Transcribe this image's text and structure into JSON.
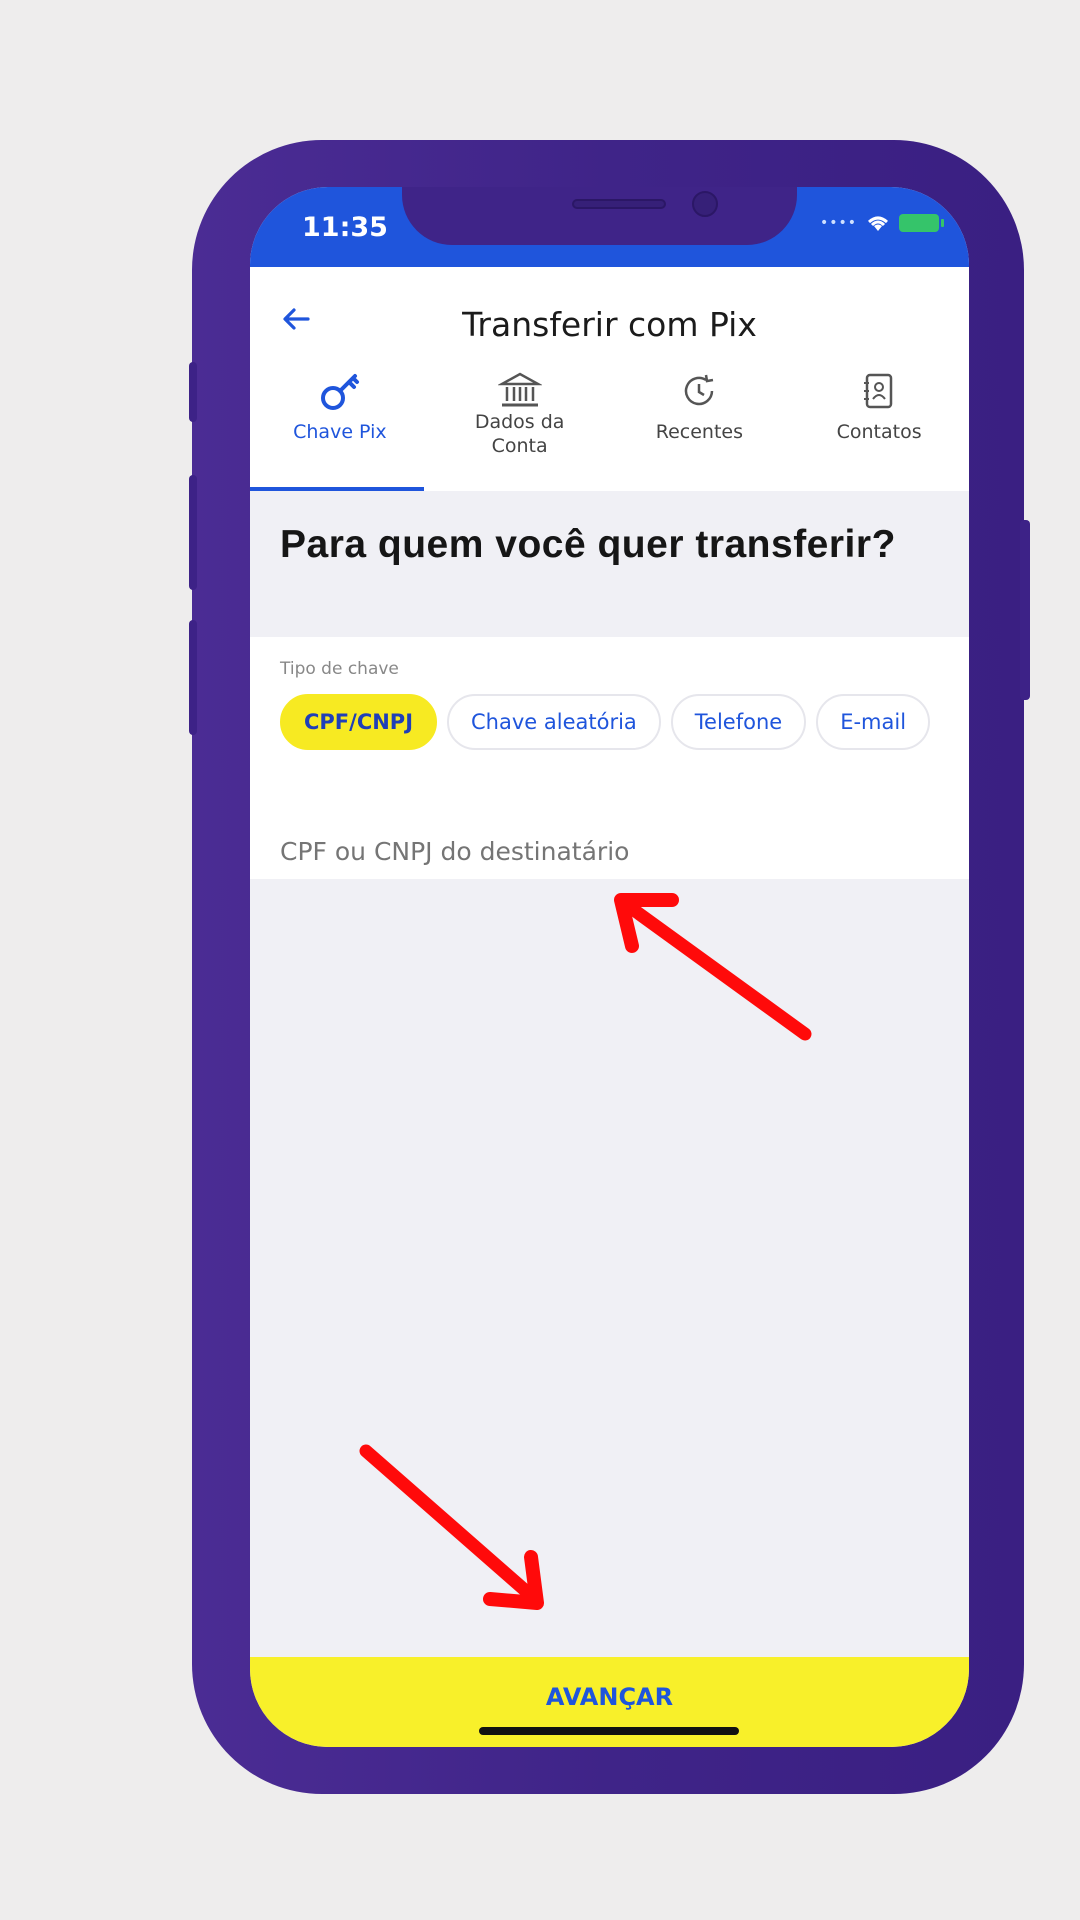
{
  "status_bar": {
    "time": "11:35"
  },
  "header": {
    "title": "Transferir com Pix"
  },
  "tabs": [
    {
      "label": "Chave Pix",
      "icon": "pix-key-icon",
      "active": true
    },
    {
      "label": "Dados da Conta",
      "icon": "bank-icon",
      "active": false
    },
    {
      "label": "Recentes",
      "icon": "history-icon",
      "active": false
    },
    {
      "label": "Contatos",
      "icon": "contacts-icon",
      "active": false
    }
  ],
  "main": {
    "heading": "Para quem você quer transferir?",
    "key_type_label": "Tipo de chave",
    "key_types": [
      "CPF/CNPJ",
      "Chave aleatória",
      "Telefone",
      "E-mail"
    ],
    "selected_key_type": "CPF/CNPJ",
    "recipient_input": {
      "value": "",
      "placeholder": "CPF ou CNPJ do destinatário"
    }
  },
  "footer": {
    "button_label": "AVANÇAR"
  },
  "colors": {
    "brand_blue": "#1f55dc",
    "highlight_yellow": "#f7ea22",
    "phone_frame": "#3f2488",
    "annotation_red": "#ff0000"
  }
}
